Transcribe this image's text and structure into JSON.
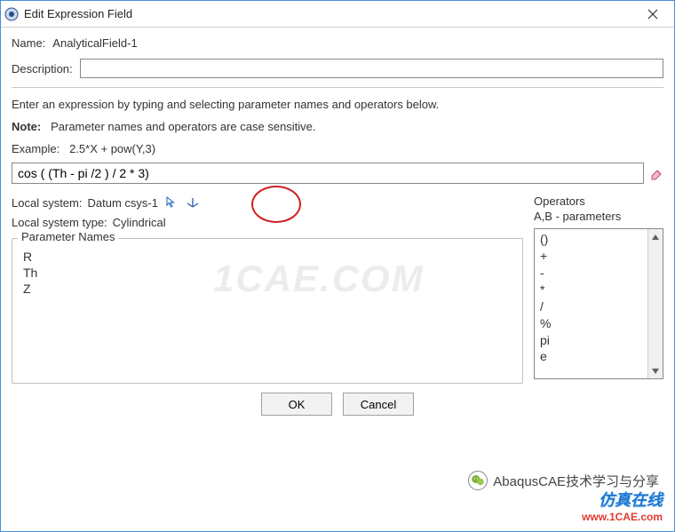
{
  "window": {
    "title": "Edit Expression Field"
  },
  "name": {
    "label": "Name:",
    "value": "AnalyticalField-1"
  },
  "description": {
    "label": "Description:",
    "value": ""
  },
  "instruction": "Enter an expression by typing and selecting parameter names and operators below.",
  "note": {
    "label": "Note:",
    "text": "Parameter names and operators are case sensitive."
  },
  "example": {
    "label": "Example:",
    "text": "2.5*X + pow(Y,3)"
  },
  "expression": {
    "value": "cos ( (Th - pi /2 ) / 2 * 3)"
  },
  "local_system": {
    "label": "Local system:",
    "value": "Datum csys-1"
  },
  "local_system_type": {
    "label": "Local system type:",
    "value": "Cylindrical"
  },
  "parameters": {
    "title": "Parameter Names",
    "items": [
      "R",
      "Th",
      "Z"
    ]
  },
  "operators": {
    "title": "Operators",
    "subtitle": "A,B - parameters",
    "items": [
      "()",
      "+",
      "-",
      "*",
      "/",
      "%",
      "pi",
      "e"
    ]
  },
  "buttons": {
    "ok": "OK",
    "cancel": "Cancel"
  },
  "overlay": {
    "channel": "AbaqusCAE技术学习与分享",
    "brand_cn": "仿真在线",
    "brand_url": "www.1CAE.com"
  },
  "watermark": "1CAE.COM"
}
